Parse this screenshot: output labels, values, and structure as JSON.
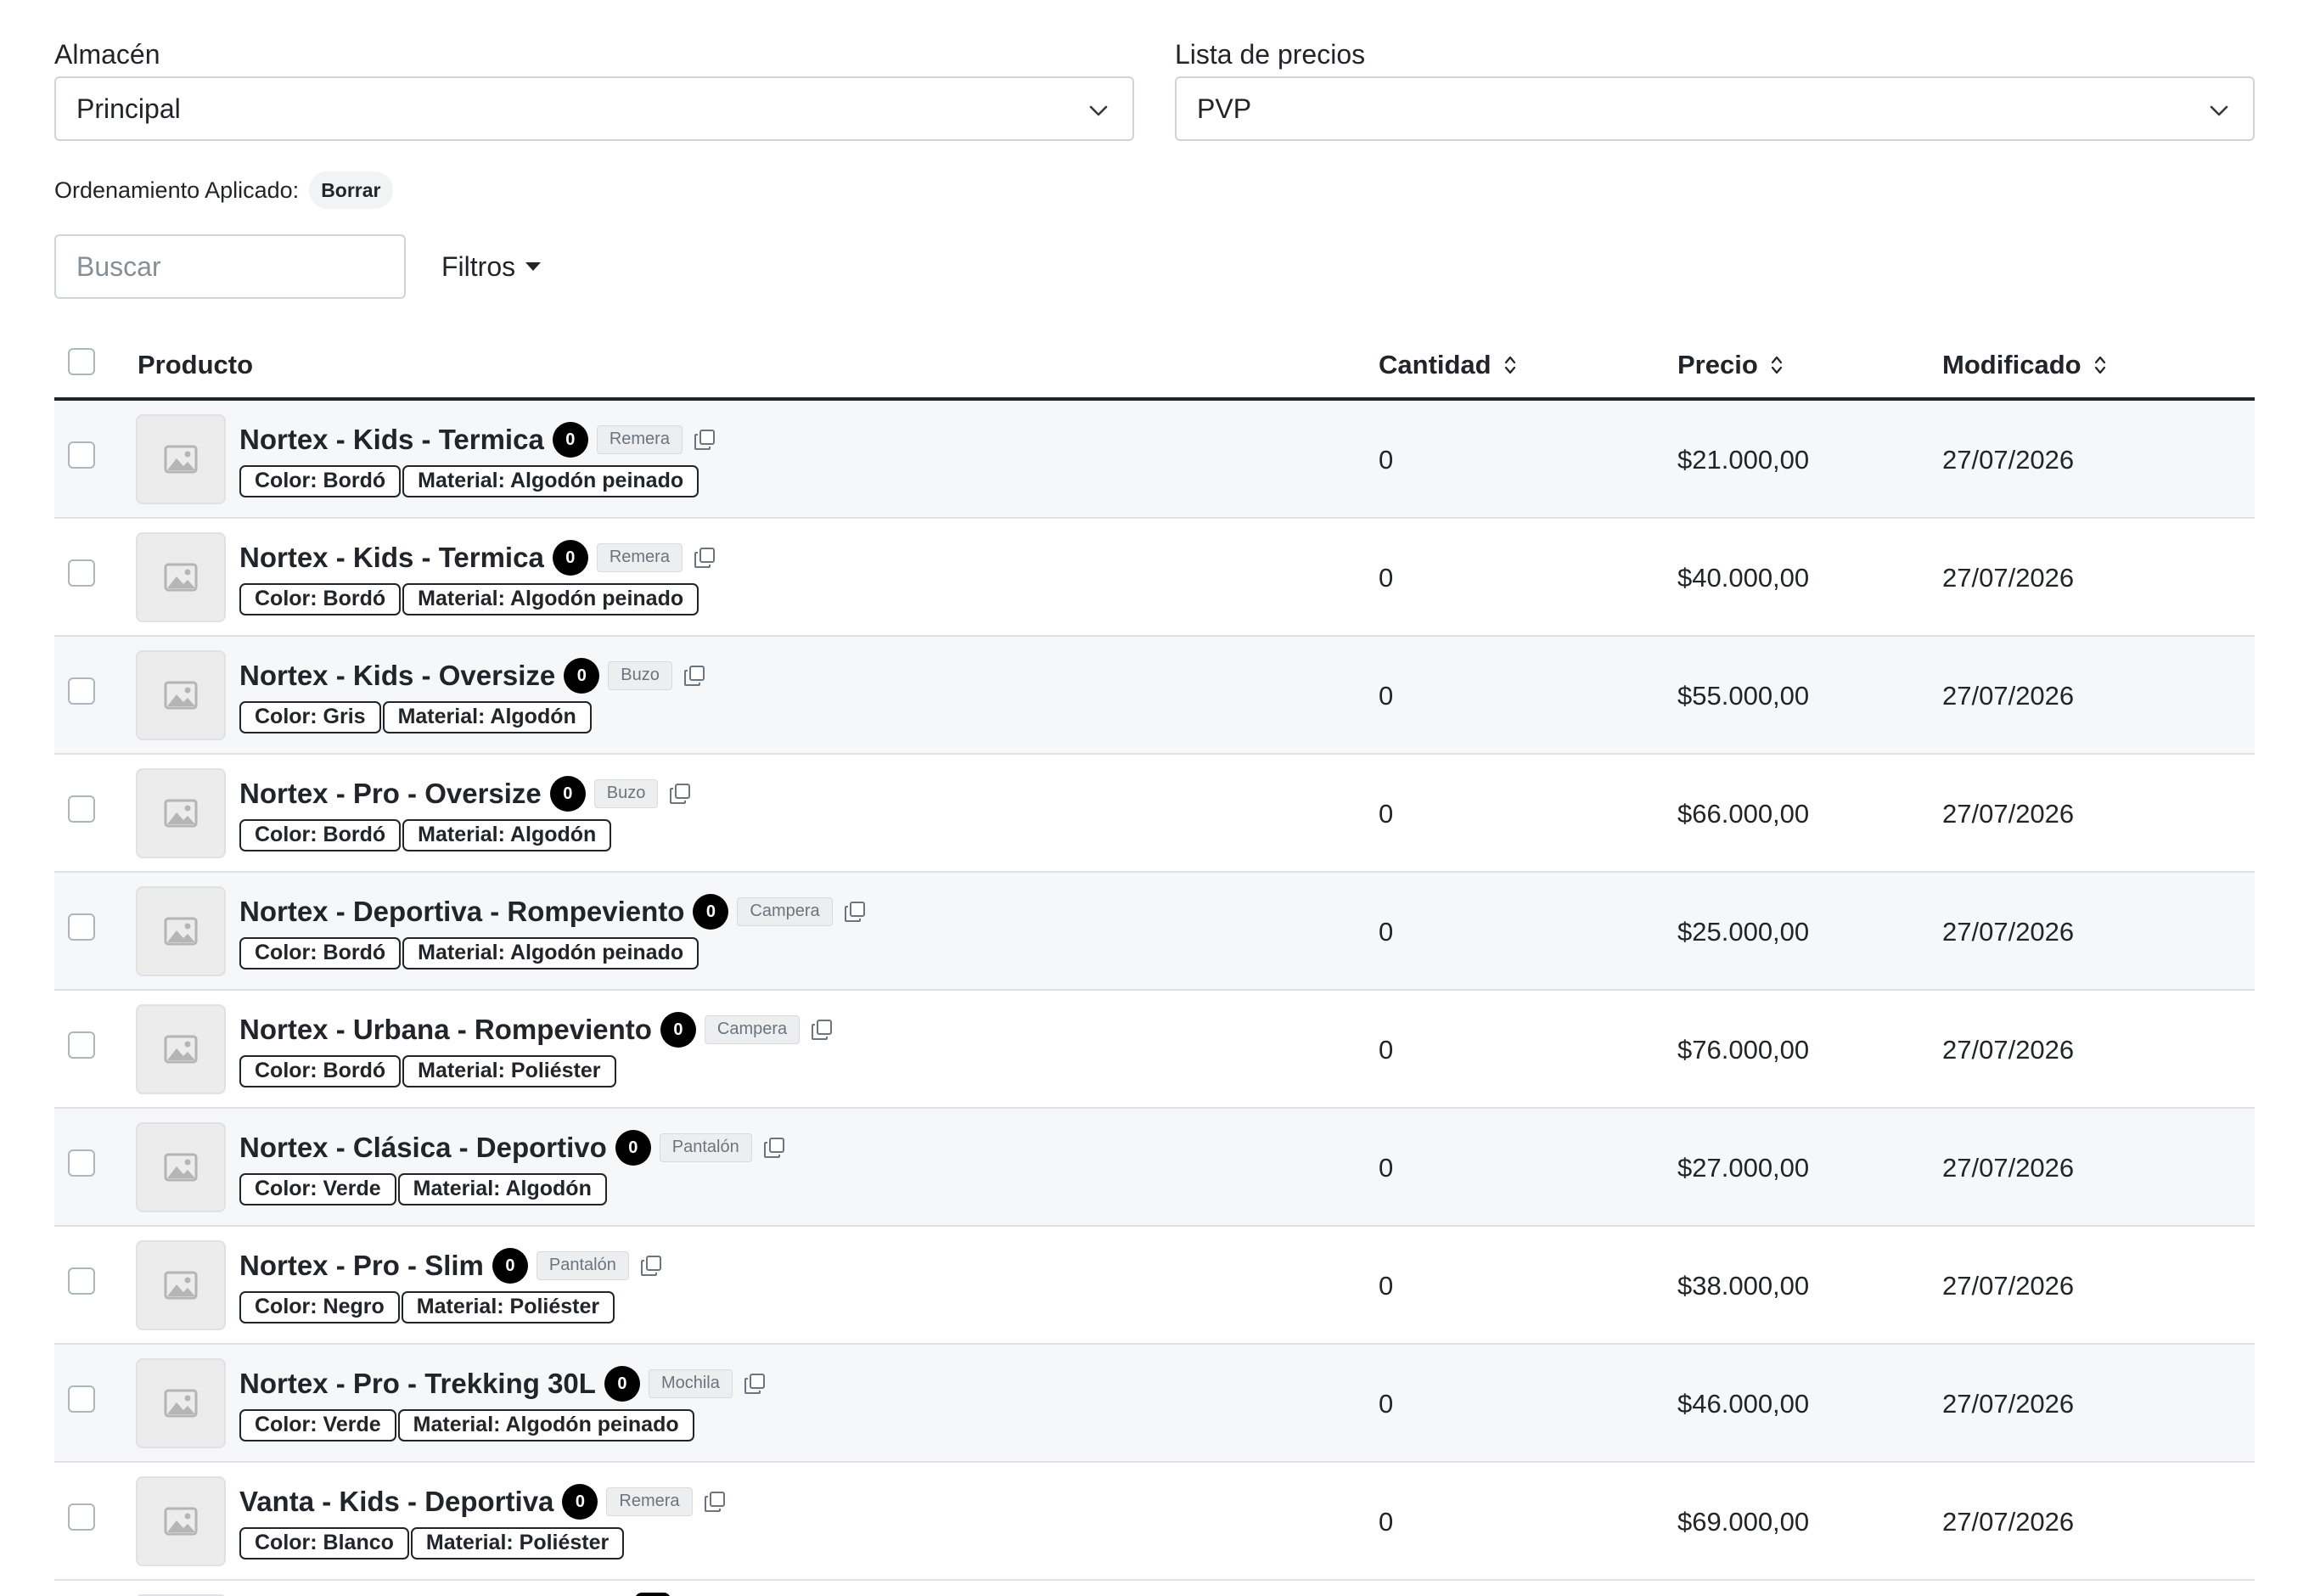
{
  "warehouse": {
    "label": "Almacén",
    "value": "Principal"
  },
  "price_list": {
    "label": "Lista de precios",
    "value": "PVP"
  },
  "sorting": {
    "label": "Ordenamiento Aplicado:",
    "clear_label": "Borrar"
  },
  "search": {
    "placeholder": "Buscar"
  },
  "filters": {
    "label": "Filtros"
  },
  "table": {
    "columns": {
      "product": "Producto",
      "quantity": "Cantidad",
      "price": "Precio",
      "modified": "Modificado"
    },
    "rows": [
      {
        "name": "Nortex - Kids - Termica",
        "stock": "0",
        "category": "Remera",
        "attrs": [
          "Color: Bordó",
          "Material: Algodón peinado"
        ],
        "quantity": "0",
        "price": "$21.000,00",
        "modified": "27/07/2026"
      },
      {
        "name": "Nortex - Kids - Termica",
        "stock": "0",
        "category": "Remera",
        "attrs": [
          "Color: Bordó",
          "Material: Algodón peinado"
        ],
        "quantity": "0",
        "price": "$40.000,00",
        "modified": "27/07/2026"
      },
      {
        "name": "Nortex - Kids - Oversize",
        "stock": "0",
        "category": "Buzo",
        "attrs": [
          "Color: Gris",
          "Material: Algodón"
        ],
        "quantity": "0",
        "price": "$55.000,00",
        "modified": "27/07/2026"
      },
      {
        "name": "Nortex - Pro - Oversize",
        "stock": "0",
        "category": "Buzo",
        "attrs": [
          "Color: Bordó",
          "Material: Algodón"
        ],
        "quantity": "0",
        "price": "$66.000,00",
        "modified": "27/07/2026"
      },
      {
        "name": "Nortex - Deportiva - Rompeviento",
        "stock": "0",
        "category": "Campera",
        "attrs": [
          "Color: Bordó",
          "Material: Algodón peinado"
        ],
        "quantity": "0",
        "price": "$25.000,00",
        "modified": "27/07/2026"
      },
      {
        "name": "Nortex - Urbana - Rompeviento",
        "stock": "0",
        "category": "Campera",
        "attrs": [
          "Color: Bordó",
          "Material: Poliéster"
        ],
        "quantity": "0",
        "price": "$76.000,00",
        "modified": "27/07/2026"
      },
      {
        "name": "Nortex - Clásica - Deportivo",
        "stock": "0",
        "category": "Pantalón",
        "attrs": [
          "Color: Verde",
          "Material: Algodón"
        ],
        "quantity": "0",
        "price": "$27.000,00",
        "modified": "27/07/2026"
      },
      {
        "name": "Nortex - Pro - Slim",
        "stock": "0",
        "category": "Pantalón",
        "attrs": [
          "Color: Negro",
          "Material: Poliéster"
        ],
        "quantity": "0",
        "price": "$38.000,00",
        "modified": "27/07/2026"
      },
      {
        "name": "Nortex - Pro - Trekking 30L",
        "stock": "0",
        "category": "Mochila",
        "attrs": [
          "Color: Verde",
          "Material: Algodón peinado"
        ],
        "quantity": "0",
        "price": "$46.000,00",
        "modified": "27/07/2026"
      },
      {
        "name": "Vanta - Kids - Deportiva",
        "stock": "0",
        "category": "Remera",
        "attrs": [
          "Color: Blanco",
          "Material: Poliéster"
        ],
        "quantity": "0",
        "price": "$69.000,00",
        "modified": "27/07/2026"
      }
    ]
  }
}
